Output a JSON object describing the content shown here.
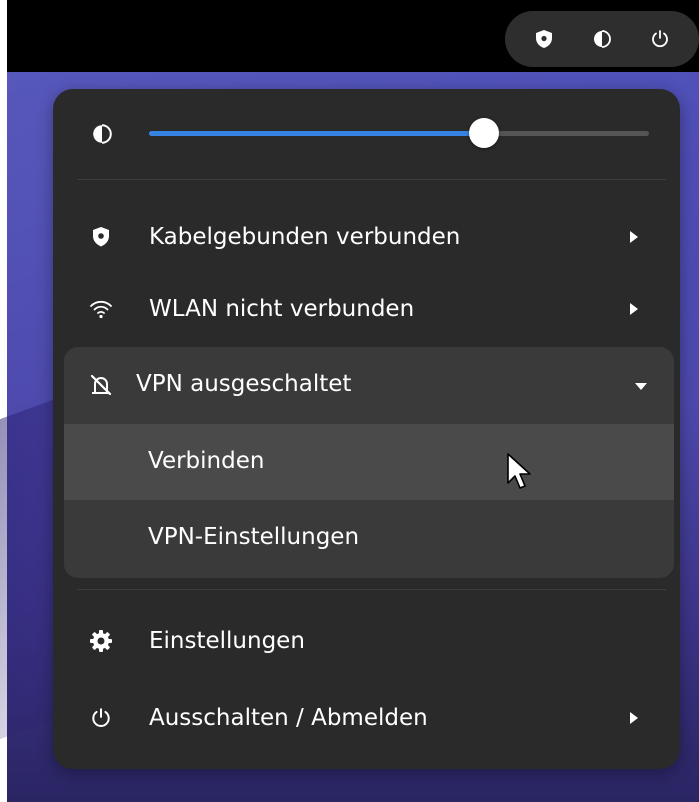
{
  "topbar": {
    "status_icons": [
      "vpn-shield-icon",
      "volume-icon",
      "power-icon"
    ]
  },
  "menu": {
    "volume": {
      "icon": "volume-icon",
      "level": 0.67
    },
    "items": [
      {
        "icon": "shield-icon",
        "label": "Kabelgebunden verbunden",
        "has_submenu": true
      },
      {
        "icon": "wifi-icon",
        "label": "WLAN nicht verbunden",
        "has_submenu": true
      }
    ],
    "vpn": {
      "icon": "vpn-off-icon",
      "label": "VPN ausgeschaltet",
      "expanded": true,
      "submenu": [
        {
          "label": "Verbinden",
          "hovered": true
        },
        {
          "label": "VPN-Einstellungen",
          "hovered": false
        }
      ]
    },
    "bottom_items": [
      {
        "icon": "gear-icon",
        "label": "Einstellungen",
        "has_submenu": false
      },
      {
        "icon": "power-icon",
        "label": "Ausschalten / Abmelden",
        "has_submenu": true
      }
    ]
  },
  "colors": {
    "accent": "#3584e4",
    "menu_bg": "#2a2a2a",
    "group_bg": "#3a3a3a",
    "hover_bg": "#4a4a4a"
  }
}
